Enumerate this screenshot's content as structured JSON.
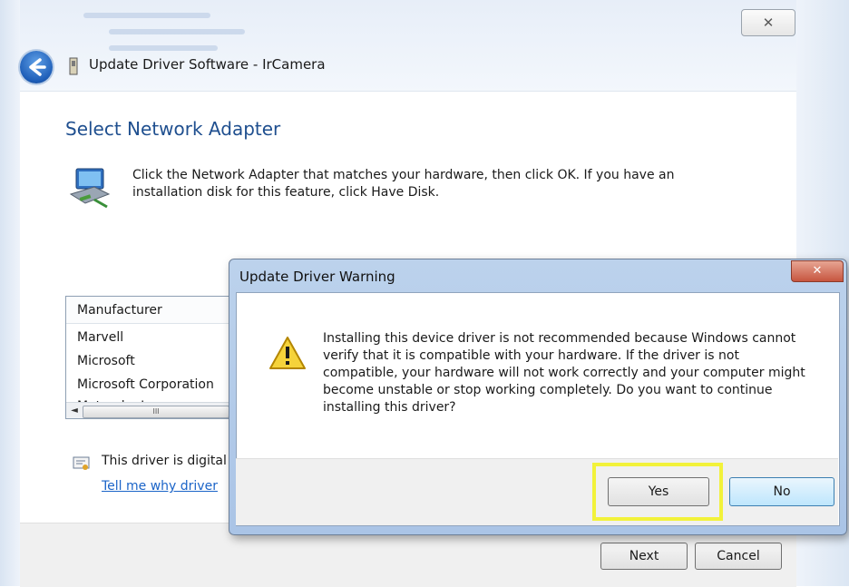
{
  "window": {
    "title": "Update Driver Software - IrCamera",
    "close_glyph": "✕",
    "back_icon": "back-arrow-icon"
  },
  "page": {
    "heading": "Select Network Adapter",
    "instructions": "Click the Network Adapter that matches your hardware, then click OK. If you have an installation disk for this feature, click Have Disk.",
    "manufacturer_header": "Manufacturer",
    "manufacturers": [
      "Marvell",
      "Microsoft",
      "Microsoft Corporation",
      "Motorola, Inc"
    ],
    "scroll_thumb_glyph": "III",
    "scroll_left_glyph": "◄",
    "signed_text": "This driver is digital",
    "why_link": "Tell me why driver",
    "next_label": "Next",
    "cancel_label": "Cancel"
  },
  "warning": {
    "title": "Update Driver Warning",
    "close_glyph": "✕",
    "message": "Installing this device driver is not recommended because Windows cannot verify that it is compatible with your hardware.  If the driver is not compatible, your hardware will not work correctly and your computer might become unstable or stop working completely.  Do you want to continue installing this driver?",
    "yes_label": "Yes",
    "no_label": "No",
    "highlight_color": "#f2f23a"
  }
}
